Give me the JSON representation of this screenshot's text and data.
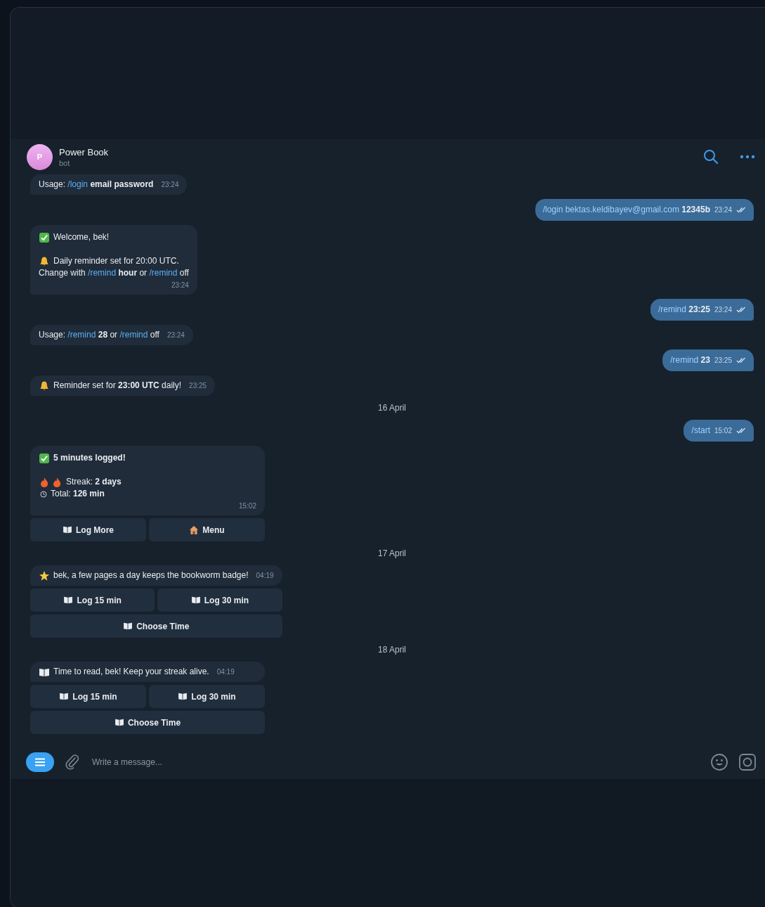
{
  "chat": {
    "avatar_letter": "P",
    "name": "Power Book",
    "status": "bot"
  },
  "messages": [
    {
      "kind": "incoming",
      "lines": [
        {
          "kind": "plain",
          "segments": [
            {
              "kind": "text",
              "text": "Usage: "
            },
            {
              "kind": "link",
              "text": "/login"
            },
            {
              "kind": "text",
              "text": " **email password**"
            }
          ]
        }
      ],
      "time": "23:24"
    },
    {
      "kind": "outgoing",
      "segments": [
        {
          "kind": "link",
          "text": "/login bektas.keldibayev@gmail.com"
        },
        {
          "kind": "text",
          "text": " **12345b**"
        }
      ],
      "time": "23:24",
      "read": true
    },
    {
      "kind": "incoming",
      "lines": [
        {
          "kind": "check",
          "segments": [
            {
              "kind": "text",
              "text": "Welcome, bek!"
            }
          ]
        },
        {
          "kind": "blank"
        },
        {
          "kind": "bell",
          "segments": [
            {
              "kind": "text",
              "text": "Daily reminder set for 20:00 UTC."
            }
          ]
        },
        {
          "kind": "plain",
          "segments": [
            {
              "kind": "text",
              "text": "Change with "
            },
            {
              "kind": "link",
              "text": "/remind"
            },
            {
              "kind": "text",
              "text": " **hour** or "
            },
            {
              "kind": "link",
              "text": "/remind"
            },
            {
              "kind": "text",
              "text": " off"
            }
          ]
        }
      ],
      "time": "23:24"
    },
    {
      "kind": "outgoing",
      "segments": [
        {
          "kind": "link",
          "text": "/remind"
        },
        {
          "kind": "text",
          "text": " **23:25**"
        }
      ],
      "time": "23:24",
      "read": true
    },
    {
      "kind": "incoming",
      "lines": [
        {
          "kind": "plain",
          "segments": [
            {
              "kind": "text",
              "text": "Usage: "
            },
            {
              "kind": "link",
              "text": "/remind"
            },
            {
              "kind": "text",
              "text": " **28** or "
            },
            {
              "kind": "link",
              "text": "/remind"
            },
            {
              "kind": "text",
              "text": " off"
            }
          ]
        }
      ],
      "time": "23:24"
    },
    {
      "kind": "outgoing",
      "segments": [
        {
          "kind": "link",
          "text": "/remind"
        },
        {
          "kind": "text",
          "text": " **23**"
        }
      ],
      "time": "23:25",
      "read": true
    },
    {
      "kind": "incoming",
      "lines": [
        {
          "kind": "bell",
          "segments": [
            {
              "kind": "text",
              "text": "Reminder set for **23:00 UTC** daily!"
            }
          ]
        }
      ],
      "time": "23:25"
    },
    {
      "kind": "date",
      "label": "16 April"
    },
    {
      "kind": "outgoing",
      "segments": [
        {
          "kind": "link",
          "text": "/start"
        }
      ],
      "time": "15:02",
      "read": true
    },
    {
      "kind": "incoming",
      "lines": [
        {
          "kind": "check",
          "segments": [
            {
              "kind": "text",
              "text": "**5 minutes logged!**"
            }
          ]
        },
        {
          "kind": "blank"
        },
        {
          "kind": "fire",
          "segments": [
            {
              "kind": "text",
              "text": "Streak: **2 days**"
            }
          ]
        },
        {
          "kind": "clock",
          "segments": [
            {
              "kind": "text",
              "text": "Total: **126 min**"
            }
          ]
        }
      ],
      "time": "15:02",
      "keyboard": [
        [
          {
            "kind": "book",
            "label": "Log More"
          },
          {
            "kind": "house",
            "label": "Menu"
          }
        ]
      ]
    },
    {
      "kind": "date",
      "label": "17 April"
    },
    {
      "kind": "incoming",
      "lines": [
        {
          "kind": "star",
          "segments": [
            {
              "kind": "text",
              "text": "bek, a few pages a day keeps the bookworm badge!"
            }
          ]
        }
      ],
      "time": "04:19",
      "keyboard": [
        [
          {
            "kind": "book",
            "label": "Log 15 min"
          },
          {
            "kind": "book",
            "label": "Log 30 min"
          }
        ],
        [
          {
            "kind": "book",
            "label": "Choose Time"
          }
        ]
      ]
    },
    {
      "kind": "date",
      "label": "18 April"
    },
    {
      "kind": "incoming",
      "lines": [
        {
          "kind": "book",
          "segments": [
            {
              "kind": "text",
              "text": "Time to read, bek! Keep your streak alive."
            }
          ]
        }
      ],
      "time": "04:19",
      "keyboard": [
        [
          {
            "kind": "book",
            "label": "Log 15 min"
          },
          {
            "kind": "book",
            "label": "Log 30 min"
          }
        ],
        [
          {
            "kind": "book",
            "label": "Choose Time"
          }
        ]
      ]
    }
  ],
  "composer": {
    "placeholder": "Write a message..."
  }
}
